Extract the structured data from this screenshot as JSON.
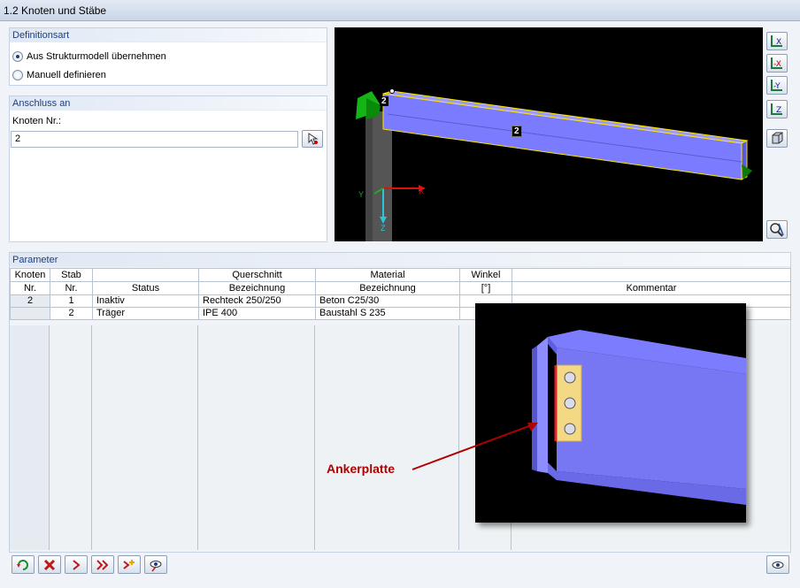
{
  "window": {
    "title": "1.2 Knoten und Stäbe"
  },
  "definitionsart": {
    "heading": "Definitionsart",
    "options": [
      {
        "label": "Aus Strukturmodell übernehmen",
        "selected": true
      },
      {
        "label": "Manuell definieren",
        "selected": false
      }
    ]
  },
  "anschluss": {
    "heading": "Anschluss an",
    "knoten_label": "Knoten Nr.:",
    "knoten_value": "2"
  },
  "viewport": {
    "node_label": "2",
    "member_label": "2",
    "axis_x": "X",
    "axis_y": "Y",
    "axis_z": "Z"
  },
  "view_buttons": [
    "view-x-icon",
    "view-minus-x-icon",
    "view-minus-y-icon",
    "view-z-icon",
    "isometric-view-icon",
    "reset-zoom-icon"
  ],
  "parameter": {
    "heading": "Parameter",
    "columns": [
      {
        "line1": "Knoten",
        "line2": "Nr."
      },
      {
        "line1": "Stab",
        "line2": "Nr."
      },
      {
        "line1": "",
        "line2": "Status"
      },
      {
        "line1": "Querschnitt",
        "line2": "Bezeichnung"
      },
      {
        "line1": "Material",
        "line2": "Bezeichnung"
      },
      {
        "line1": "Winkel",
        "line2": "[°]"
      },
      {
        "line1": "",
        "line2": "Kommentar"
      }
    ],
    "rows": [
      {
        "knoten": "2",
        "stab": "1",
        "status": "Inaktiv",
        "querschnitt": "Rechteck 250/250",
        "material": "Beton C25/30",
        "winkel": "",
        "kommentar": ""
      },
      {
        "knoten": "",
        "stab": "2",
        "status": "Träger",
        "querschnitt": "IPE 400",
        "material": "Baustahl S 235",
        "winkel": "",
        "kommentar": ""
      }
    ]
  },
  "callout": {
    "label": "Ankerplatte"
  },
  "colors": {
    "callout": "#b00000",
    "beam": "#7b7bff",
    "plate": "#f4d985"
  },
  "toolbar": [
    "refresh-icon",
    "delete-icon",
    "next-icon",
    "last-icon",
    "add-icon",
    "view-icon"
  ]
}
